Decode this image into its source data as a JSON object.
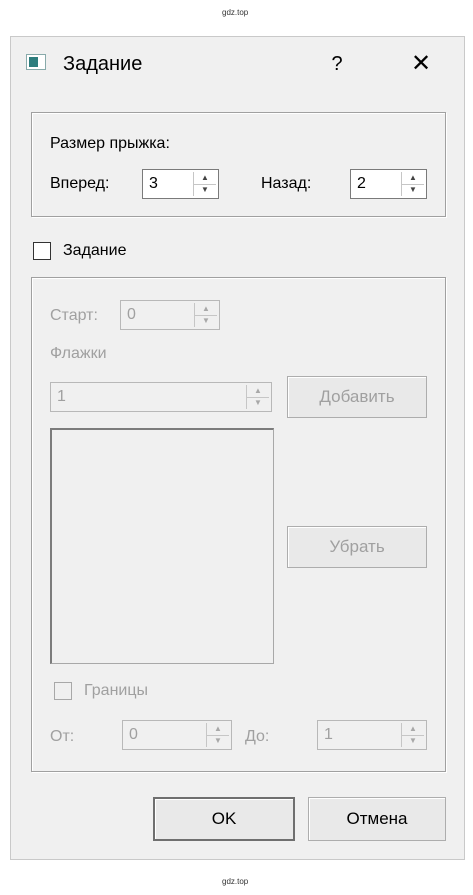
{
  "watermark_top": "gdz.top",
  "watermark_bottom": "gdz.top",
  "window": {
    "title": "Задание",
    "help_label": "?",
    "close_label": "✕"
  },
  "jump_size": {
    "heading": "Размер прыжка:",
    "forward_label": "Вперед:",
    "forward_value": "3",
    "back_label": "Назад:",
    "back_value": "2"
  },
  "task_checkbox": {
    "label": "Задание",
    "checked": false
  },
  "task_group": {
    "start_label": "Старт:",
    "start_value": "0",
    "flags_label": "Флажки",
    "flag_value": "1",
    "add_button": "Добавить",
    "remove_button": "Убрать",
    "bounds_label": "Границы",
    "from_label": "От:",
    "from_value": "0",
    "to_label": "До:",
    "to_value": "1"
  },
  "buttons": {
    "ok": "OK",
    "cancel": "Отмена"
  },
  "icons": {
    "spin_up": "▲",
    "spin_down": "▼"
  }
}
